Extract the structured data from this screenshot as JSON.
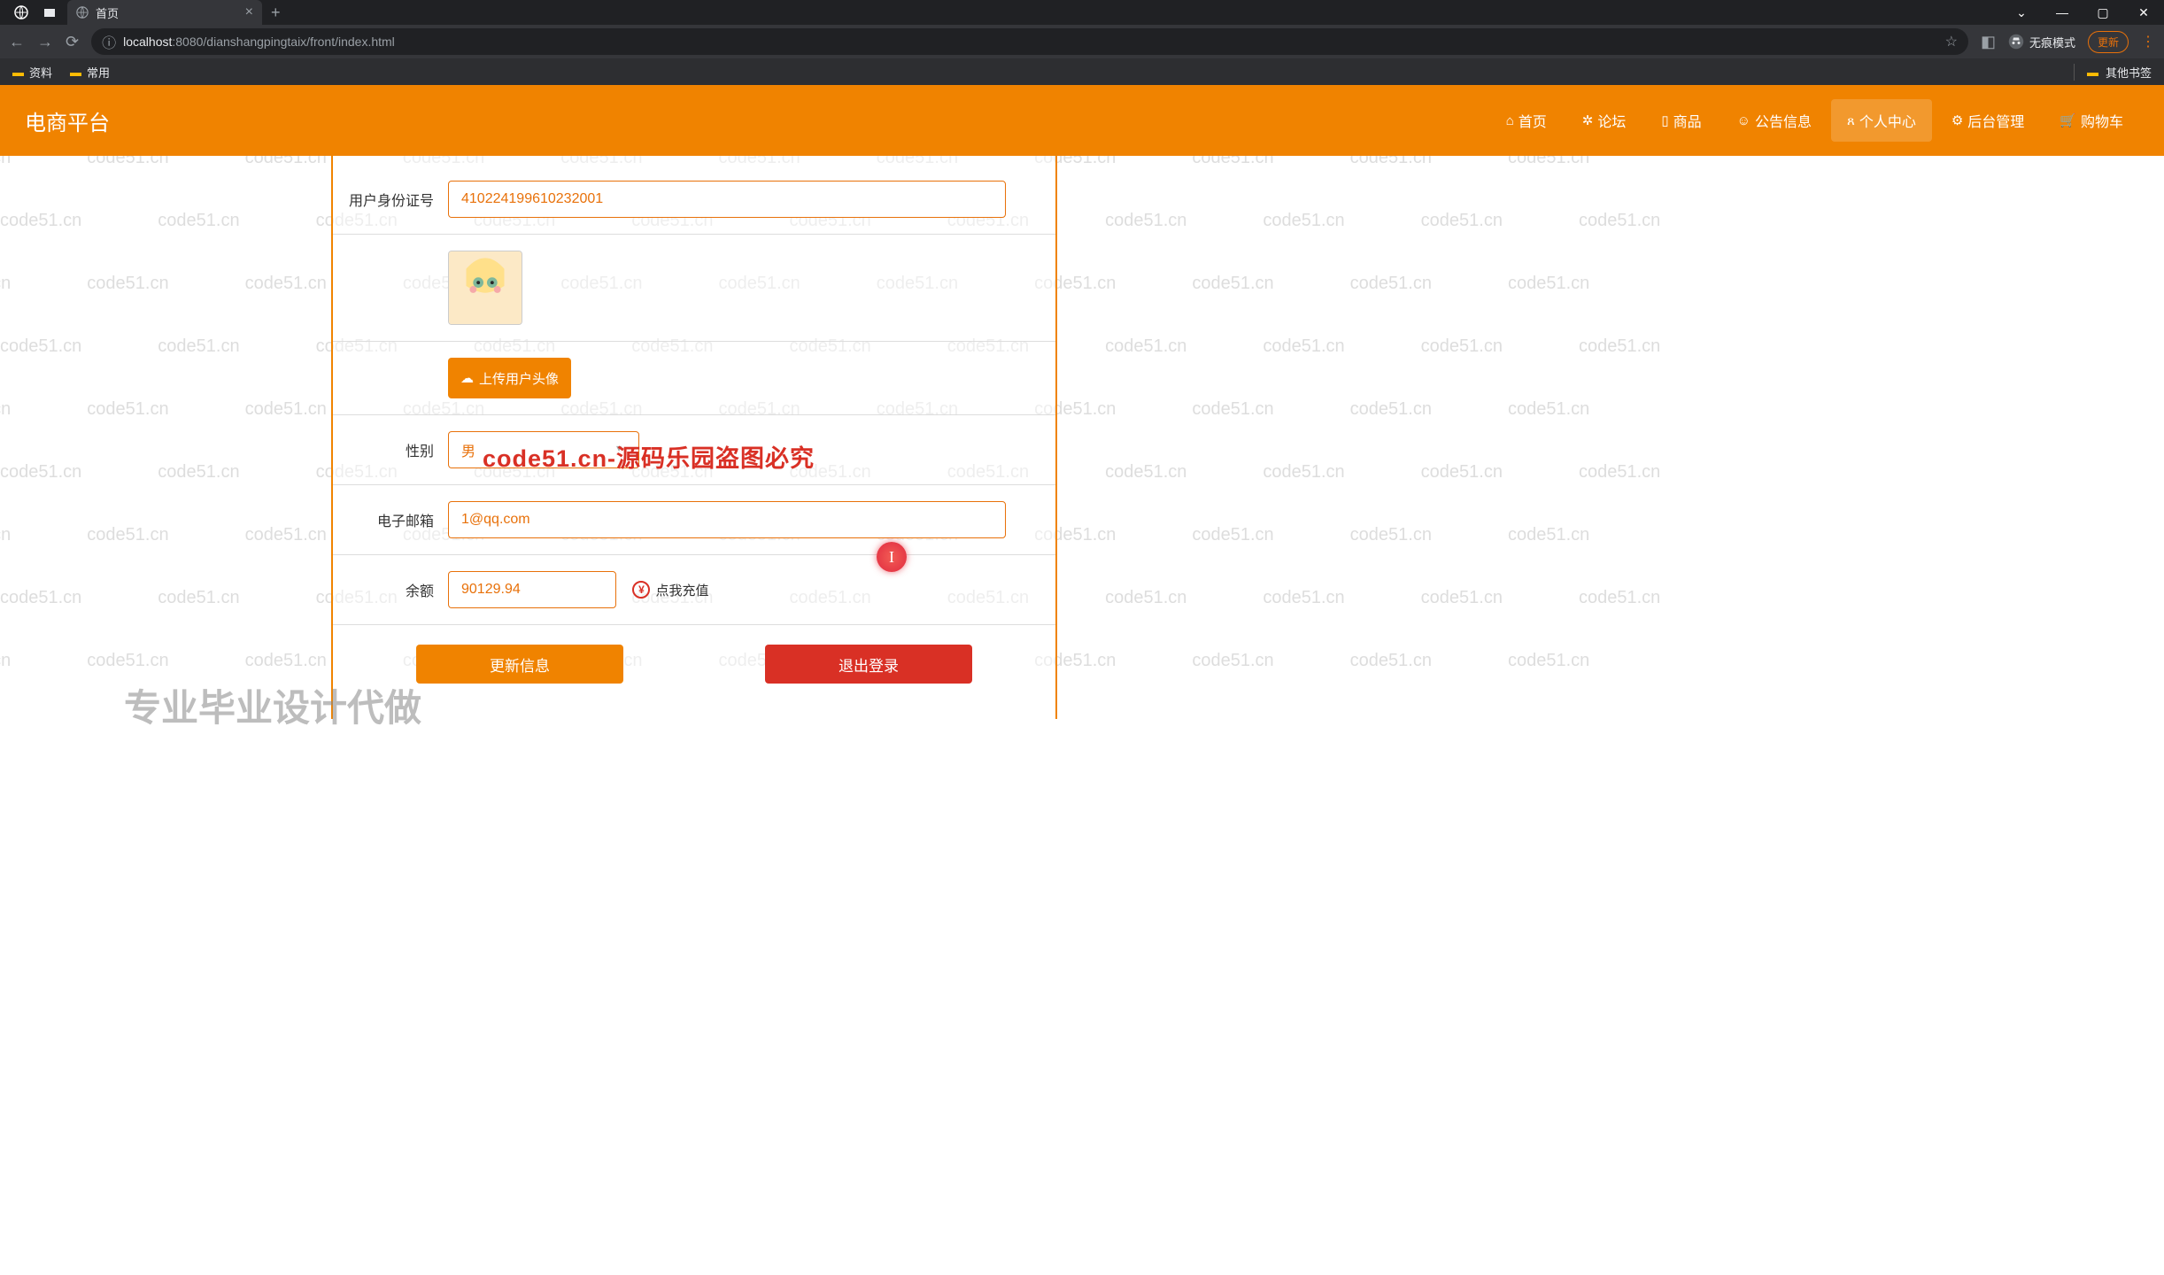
{
  "browser": {
    "tab_title": "首页",
    "url_host": "localhost",
    "url_port": ":8080",
    "url_path": "/dianshangpingtaix/front/index.html",
    "incognito_label": "无痕模式",
    "update_label": "更新",
    "bookmarks": {
      "b1": "资料",
      "b2": "常用",
      "other": "其他书签"
    }
  },
  "site": {
    "brand": "电商平台",
    "nav": {
      "home": "首页",
      "forum": "论坛",
      "goods": "商品",
      "notice": "公告信息",
      "center": "个人中心",
      "admin": "后台管理",
      "cart": "购物车"
    }
  },
  "form": {
    "id_label": "用户身份证号",
    "id_value": "410224199610232001",
    "upload_label": "上传用户头像",
    "gender_label": "性别",
    "gender_value": "男",
    "email_label": "电子邮箱",
    "email_value": "1@qq.com",
    "balance_label": "余额",
    "balance_value": "90129.94",
    "recharge_label": "点我充值",
    "update_btn": "更新信息",
    "logout_btn": "退出登录"
  },
  "watermark": {
    "text": "code51.cn",
    "overlay1": "code51.cn-源码乐园盗图必究",
    "overlay2": "专业毕业设计代做"
  }
}
